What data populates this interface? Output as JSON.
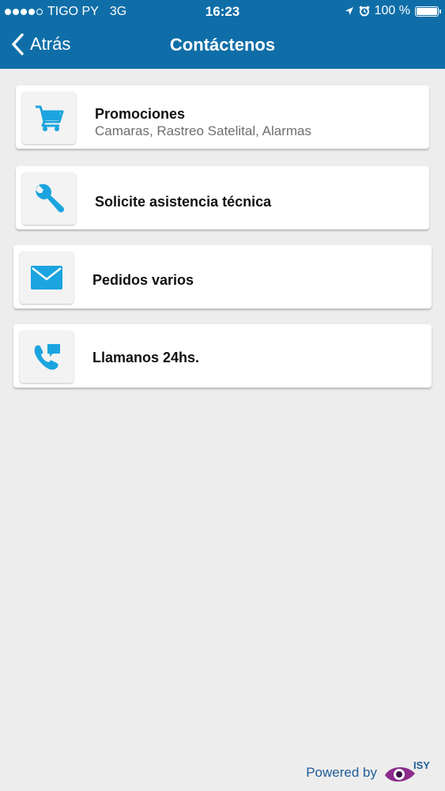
{
  "status_bar": {
    "carrier": "TIGO PY",
    "network": "3G",
    "time": "16:23",
    "battery": "100 %",
    "battery_level": 1.0,
    "signal_bars_filled": 4,
    "signal_bars_total": 5
  },
  "nav": {
    "back_label": "Atrás",
    "title": "Contáctenos"
  },
  "items": [
    {
      "title": "Promociones",
      "subtitle": "Camaras, Rastreo Satelital, Alarmas",
      "icon": "shopping-cart-icon"
    },
    {
      "title": "Solicite asistencia técnica",
      "icon": "wrench-icon"
    },
    {
      "title": "Pedidos varios",
      "icon": "envelope-icon"
    },
    {
      "title": "Llamanos 24hs.",
      "icon": "phone-icon"
    }
  ],
  "footer": {
    "powered_by": "Powered by",
    "brand": "ISY"
  },
  "colors": {
    "header": "#0F6EA8",
    "background": "#EDEDED",
    "icon": "#1BA4DF",
    "footer_text": "#1F5C96",
    "brand_purple": "#8B2C8C"
  }
}
